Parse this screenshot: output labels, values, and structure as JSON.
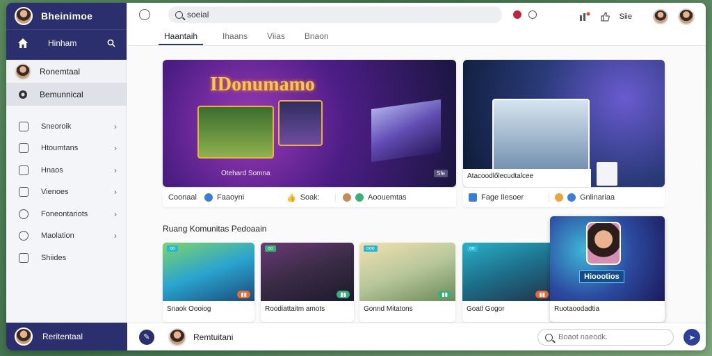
{
  "sidebar": {
    "app_title": "Bheinimoe",
    "home_label": "Hinham",
    "profile_label": "Ronemtaal",
    "community_label": "Bemunnical",
    "items": [
      {
        "label": "Sneoroik"
      },
      {
        "label": "Htoumtans"
      },
      {
        "label": "Hnaos"
      },
      {
        "label": "Vienoes"
      },
      {
        "label": "Foneontariots"
      },
      {
        "label": "Maolation"
      },
      {
        "label": "Shiides"
      }
    ],
    "footer_label": "Reritentaal"
  },
  "topbar": {
    "search_value": "soeial",
    "right_label": "Siie"
  },
  "tabs": [
    {
      "label": "Haantaih",
      "active": true
    },
    {
      "label": "Ihaans",
      "active": false
    },
    {
      "label": "Viias",
      "active": false
    },
    {
      "label": "Bnaon",
      "active": false
    }
  ],
  "feature_main": {
    "title": "IDonumamo",
    "subtitle": "Otehard Somna",
    "chip": "Sfe",
    "bar": [
      "Coonaal",
      "Faaoyni",
      "Soak:",
      "Aoouemtas"
    ]
  },
  "feature_side": {
    "caption": "Atacoodlőlecudtalcee",
    "bar": [
      "Fage Ilesoer",
      "Gnlinariaa"
    ]
  },
  "section_title": "Ruang Komunitas Pedoaain",
  "thumbs": [
    {
      "caption": "Snaok Oooiog",
      "tag": "oo"
    },
    {
      "caption": "Roodiattaitm amots",
      "tag": "oo"
    },
    {
      "caption": "Gonnd Mitatons",
      "tag": "ooo"
    },
    {
      "caption": "Goatl Gogor",
      "tag": "oo"
    }
  ],
  "thumb_big": {
    "sign": "Hioootios",
    "caption": "Ruotaoodadtia"
  },
  "bottombar": {
    "user_label": "Remtuitani",
    "search_placeholder": "Boaot naeodk."
  }
}
